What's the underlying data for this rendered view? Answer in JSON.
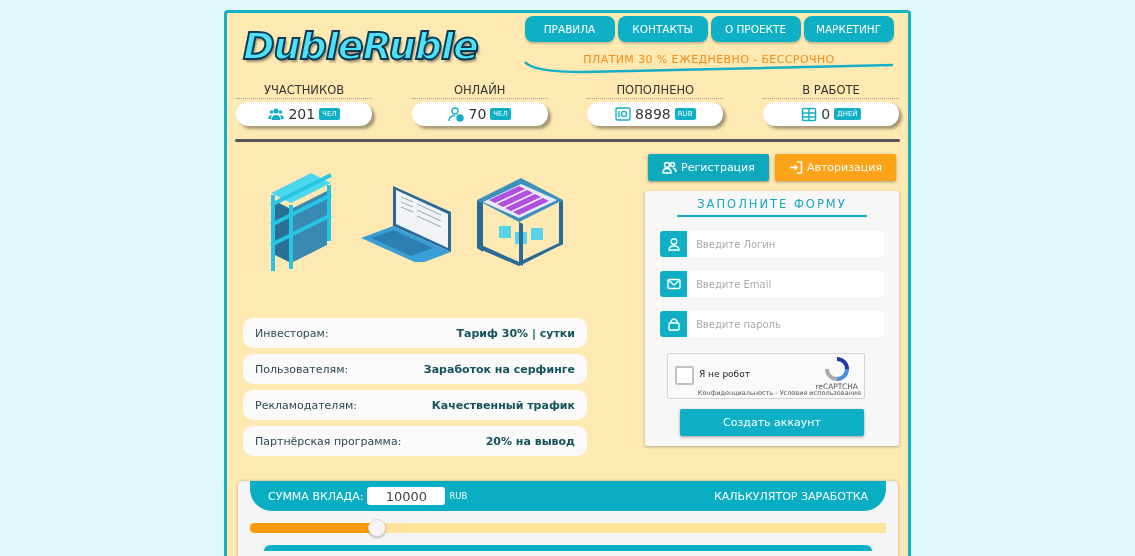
{
  "logo": "DubleRuble",
  "nav": [
    "ПРАВИЛА",
    "КОНТАКТЫ",
    "О ПРОЕКТЕ",
    "МАРКЕТИНГ"
  ],
  "slogan": "ПЛАТИМ 30 % ЕЖЕДНЕВНО - БЕССРОЧНО",
  "stats": [
    {
      "kind": "users",
      "label": "УЧАСТНИКОВ",
      "value": "201",
      "unit": "ЧЕЛ"
    },
    {
      "kind": "online",
      "label": "ОНЛАЙН",
      "value": "70",
      "unit": "ЧЕЛ"
    },
    {
      "kind": "safe",
      "label": "ПОПОЛНЕНО",
      "value": "8898",
      "unit": "RUB"
    },
    {
      "kind": "calendar",
      "label": "В РАБОТЕ",
      "value": "0",
      "unit": "ДНЕЙ"
    }
  ],
  "info": [
    {
      "label": "Инвесторам:",
      "value": "Тариф 30% | сутки"
    },
    {
      "label": "Пользователям:",
      "value": "Заработок на серфинге"
    },
    {
      "label": "Рекламодателям:",
      "value": "Качественный трафик"
    },
    {
      "label": "Партнёрская программа:",
      "value": "20% на вывод"
    }
  ],
  "auth_tabs": [
    {
      "label": "Регистрация",
      "selected": true
    },
    {
      "label": "Авторизация",
      "selected": false
    }
  ],
  "form": {
    "title": "ЗАПОЛНИТЕ ФОРМУ",
    "fields": [
      {
        "kind": "user",
        "placeholder": "Введите Логин"
      },
      {
        "kind": "mail",
        "placeholder": "Введите Email"
      },
      {
        "kind": "lock",
        "placeholder": "Введите пароль"
      }
    ],
    "captcha": {
      "checked": false,
      "label": "Я не робот",
      "brand": "reCAPTCHA",
      "links": "Конфиденциальность - Условия использования"
    },
    "submit": "Создать аккаунт"
  },
  "calculator": {
    "amount_label": "СУММА ВКЛАДА:",
    "amount": "10000",
    "currency": "RUB",
    "title": "КАЛЬКУЛЯТОР ЗАРАБОТКА",
    "level": 0.2
  }
}
